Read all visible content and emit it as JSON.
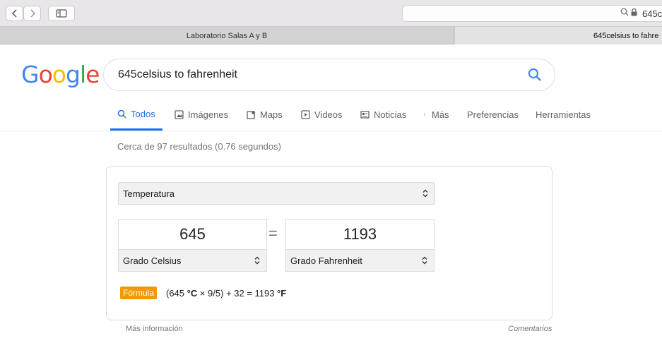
{
  "browser": {
    "address_text": "645c",
    "tabs": [
      "Laboratorio Salas A y B",
      "645celsius to fahre"
    ]
  },
  "google": {
    "logo_letters": [
      {
        "ch": "G",
        "color": "#4285f4"
      },
      {
        "ch": "o",
        "color": "#ea4335"
      },
      {
        "ch": "o",
        "color": "#fbbc05"
      },
      {
        "ch": "g",
        "color": "#4285f4"
      },
      {
        "ch": "l",
        "color": "#34a853"
      },
      {
        "ch": "e",
        "color": "#ea4335"
      }
    ],
    "query": "645celsius to fahrenheit"
  },
  "nav": {
    "todos": "Todos",
    "imagenes": "Imágenes",
    "maps": "Maps",
    "videos": "Videos",
    "noticias": "Noticias",
    "mas": "Más",
    "preferencias": "Preferencias",
    "herramientas": "Herramientas"
  },
  "stats": "Cerca de 97 resultados (0.76 segundos)",
  "converter": {
    "category": "Temperatura",
    "from_value": "645",
    "from_unit": "Grado Celsius",
    "equals": "=",
    "to_value": "1193",
    "to_unit": "Grado Fahrenheit",
    "formula_label": "Fórmula",
    "formula_pre": "(645 ",
    "formula_unit1": "°C",
    "formula_mid": " × 9/5) + 32 = 1193 ",
    "formula_unit2": "°F"
  },
  "footer": {
    "more_info": "Más información",
    "comments": "Comentarios"
  },
  "colors": {
    "accent": "#1a73e8",
    "formula_badge": "#f29900"
  }
}
